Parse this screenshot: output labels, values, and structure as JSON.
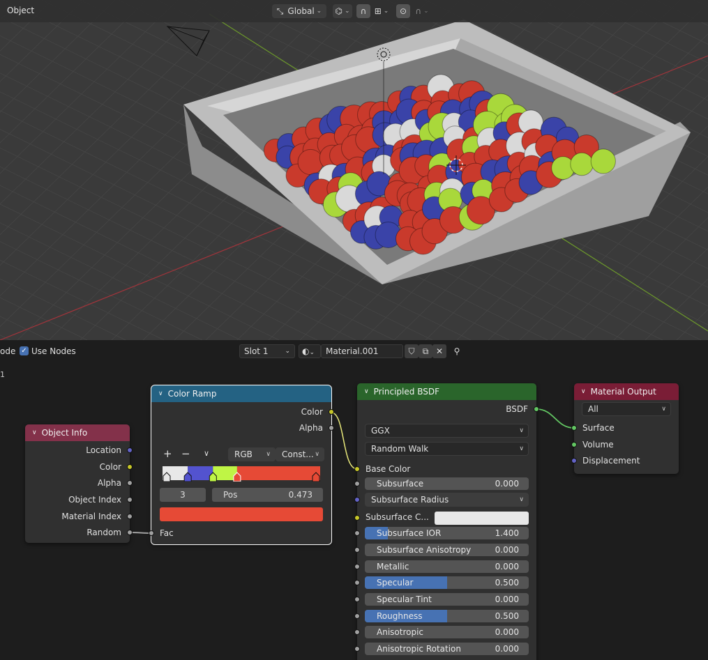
{
  "viewport": {
    "mode_label": "Object",
    "transform_orientation": "Global",
    "colors": {
      "bg": "#3a3a3a",
      "grid": "#474747",
      "axis_x": "#a1343b",
      "axis_y": "#6d9a2b",
      "box": "#bdbdbd"
    }
  },
  "editor_header": {
    "left_cut_text": "ode",
    "use_nodes_label": "Use Nodes",
    "slot": "Slot 1",
    "material_name": "Material.001",
    "left_edge_number": "1"
  },
  "nodes": {
    "object_info": {
      "title": "Object Info",
      "header_color": "#83314a",
      "outputs": [
        "Location",
        "Color",
        "Alpha",
        "Object Index",
        "Material Index",
        "Random"
      ]
    },
    "color_ramp": {
      "title": "Color Ramp",
      "header_color": "#246283",
      "outputs": [
        "Color",
        "Alpha"
      ],
      "add": "+",
      "remove": "−",
      "color_mode": "RGB",
      "interpolation": "Const...",
      "active_index": "3",
      "pos_label": "Pos",
      "pos_value": "0.473",
      "active_color": "#e64a36",
      "input": "Fac",
      "stops": [
        {
          "pos": 0.0,
          "color": "#e8e8e8"
        },
        {
          "pos": 0.16,
          "color": "#5353cf"
        },
        {
          "pos": 0.32,
          "color": "#bff545"
        },
        {
          "pos": 0.473,
          "color": "#e64a36"
        },
        {
          "pos": 1.0,
          "color": "#e64a36"
        }
      ]
    },
    "principled": {
      "title": "Principled BSDF",
      "header_color": "#2a652b",
      "output": "BSDF",
      "distribution": "GGX",
      "subsurface_method": "Random Walk",
      "base_color": "Base Color",
      "subsurface": {
        "label": "Subsurface",
        "value": "0.000"
      },
      "subsurface_radius": "Subsurface Radius",
      "subsurface_color": "Subsurface C...",
      "subsurface_color_value": "#e8e8e8",
      "subsurface_ior": {
        "label": "Subsurface IOR",
        "value": "1.400",
        "fill": 0.14
      },
      "subsurface_anisotropy": {
        "label": "Subsurface Anisotropy",
        "value": "0.000"
      },
      "metallic": {
        "label": "Metallic",
        "value": "0.000"
      },
      "specular": {
        "label": "Specular",
        "value": "0.500",
        "fill": 0.5
      },
      "specular_tint": {
        "label": "Specular Tint",
        "value": "0.000"
      },
      "roughness": {
        "label": "Roughness",
        "value": "0.500",
        "fill": 0.5
      },
      "anisotropic": {
        "label": "Anisotropic",
        "value": "0.000"
      },
      "anisotropic_rotation": {
        "label": "Anisotropic Rotation",
        "value": "0.000"
      }
    },
    "material_output": {
      "title": "Material Output",
      "header_color": "#7a1d36",
      "target": "All",
      "inputs": [
        "Surface",
        "Volume",
        "Displacement"
      ]
    }
  }
}
